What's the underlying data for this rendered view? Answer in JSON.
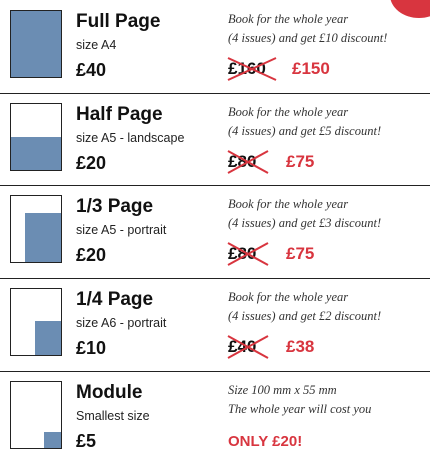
{
  "rows": [
    {
      "name": "Full Page",
      "size": "size A4",
      "price": "£40",
      "offer_line1": "Book for the whole year",
      "offer_line2": "(4 issues) and get £10 discount!",
      "old_price": "£160",
      "new_price": "£150"
    },
    {
      "name": "Half Page",
      "size": "size A5 - landscape",
      "price": "£20",
      "offer_line1": "Book for the whole year",
      "offer_line2": "(4 issues) and get £5 discount!",
      "old_price": "£80",
      "new_price": "£75"
    },
    {
      "name": "1/3 Page",
      "size": "size A5 - portrait",
      "price": "£20",
      "offer_line1": "Book for the whole year",
      "offer_line2": "(4 issues) and get £3 discount!",
      "old_price": "£80",
      "new_price": "£75"
    },
    {
      "name": "1/4 Page",
      "size": "size A6 - portrait",
      "price": "£10",
      "offer_line1": "Book for the whole year",
      "offer_line2": "(4 issues) and get £2 discount!",
      "old_price": "£40",
      "new_price": "£38"
    },
    {
      "name": "Module",
      "size": "Smallest size",
      "price": "£5",
      "offer_line1": "Size 100 mm x 55 mm",
      "offer_line2": "The whole year will cost you",
      "highlight": "ONLY £20!"
    }
  ],
  "colors": {
    "accent": "#d8353f",
    "fill": "#6b8db3",
    "text": "#111111"
  }
}
